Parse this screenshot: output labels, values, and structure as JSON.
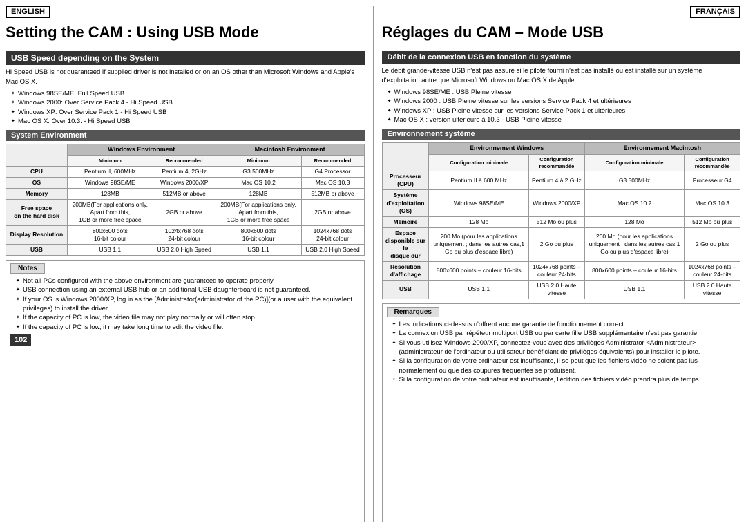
{
  "english": {
    "badge": "ENGLISH",
    "title": "Setting the CAM : Using USB Mode",
    "usb_speed_header": "USB Speed depending on the System",
    "intro": "Hi Speed USB is not guaranteed if supplied driver is not installed or on an OS other than Microsoft Windows and Apple's Mac OS X.",
    "bullets": [
      "Windows 98SE/ME: Full Speed USB",
      "Windows 2000: Over Service Pack 4 - Hi Speed USB",
      "Windows XP: Over Service Pack 1 - Hi Speed USB",
      "Mac OS X: Over 10.3. - Hi Speed USB"
    ],
    "system_env_header": "System Environment",
    "table": {
      "win_env": "Windows Environment",
      "mac_env": "Macintosh Environment",
      "min": "Minimum",
      "rec": "Recommended",
      "rows": [
        {
          "label": "CPU",
          "win_min": "Pentium II, 600MHz",
          "win_rec": "Pentium 4, 2GHz",
          "mac_min": "G3 500MHz",
          "mac_rec": "G4 Processor"
        },
        {
          "label": "OS",
          "win_min": "Windows 98SE/ME",
          "win_rec": "Windows 2000/XP",
          "mac_min": "Mac OS 10.2",
          "mac_rec": "Mac OS 10.3"
        },
        {
          "label": "Memory",
          "win_min": "128MB",
          "win_rec": "512MB or above",
          "mac_min": "128MB",
          "mac_rec": "512MB or above"
        },
        {
          "label": "Free space\non the hard disk",
          "win_min": "200MB(For applications only.\nApart from this,\n1GB or more free space",
          "win_rec": "2GB or above",
          "mac_min": "200MB(For applications only.\nApart from this,\n1GB or more free space",
          "mac_rec": "2GB or above"
        },
        {
          "label": "Display Resolution",
          "win_min": "800x600 dots\n16-bit colour",
          "win_rec": "1024x768 dots\n24-bit colour",
          "mac_min": "800x600 dots\n16-bit colour",
          "mac_rec": "1024x768 dots\n24-bit colour"
        },
        {
          "label": "USB",
          "win_min": "USB 1.1",
          "win_rec": "USB 2.0 High Speed",
          "mac_min": "USB 1.1",
          "mac_rec": "USB 2.0 High Speed"
        }
      ]
    },
    "notes_label": "Notes",
    "notes_bullets": [
      "Not all PCs configured with the above environment are guaranteed to operate properly.",
      "USB connection using an external USB hub or an additional USB daughterboard is not guaranteed.",
      "If your OS is Windows 2000/XP, log in as the [Administrator(administrator of the PC)](or a user with the equivalent privileges) to install the driver.",
      "If the capacity of PC is low, the video file may not play normally or will often stop.",
      "If the capacity of PC is low, it may take long time to edit the video file."
    ],
    "page_num": "102"
  },
  "french": {
    "badge": "FRANÇAIS",
    "title": "Réglages du CAM – Mode USB",
    "usb_speed_header": "Débit de la connexion USB en fonction du système",
    "intro": "Le débit grande-vitesse USB n'est pas assuré si le pilote fourni n'est pas installé ou est installé sur un système d'exploitation autre que Microsoft Windows ou Mac OS X de Apple.",
    "bullets": [
      "Windows 98SE/ME : USB Pleine vitesse",
      "Windows 2000 : USB Pleine vitesse sur les versions Service Pack 4 et ultérieures",
      "Windows XP : USB Pleine vitesse sur les versions Service Pack 1 et ultérieures",
      "Mac OS X : version ultérieure à 10.3 - USB Pleine vitesse"
    ],
    "system_env_header": "Environnement système",
    "table": {
      "win_env": "Environnement Windows",
      "mac_env": "Environnement Macintosh",
      "config_min": "Configuration minimale",
      "config_rec": "Configuration recommandée",
      "rows": [
        {
          "label": "Processeur\n(CPU)",
          "win_min": "Pentium II à 600 MHz",
          "win_rec": "Pentium 4 à 2 GHz",
          "mac_min": "G3 500MHz",
          "mac_rec": "Processeur G4"
        },
        {
          "label": "Système\nd'exploitation (OS)",
          "win_min": "Windows 98SE/ME",
          "win_rec": "Windows 2000/XP",
          "mac_min": "Mac OS 10.2",
          "mac_rec": "Mac OS 10.3"
        },
        {
          "label": "Mémoire",
          "win_min": "128 Mo",
          "win_rec": "512 Mo ou plus",
          "mac_min": "128 Mo",
          "mac_rec": "512 Mo ou plus"
        },
        {
          "label": "Espace\ndisponible sur le\ndisque dur",
          "win_min": "200 Mo (pour les applications uniquement ; dans les autres cas,1 Go ou plus d'espace libre)",
          "win_rec": "2 Go ou plus",
          "mac_min": "200 Mo (pour les applications uniquement ; dans les autres cas,1 Go ou plus d'espace libre)",
          "mac_rec": "2 Go ou plus"
        },
        {
          "label": "Résolution\nd'affichage",
          "win_min": "800x600 points – couleur 16-bits",
          "win_rec": "1024x768 points – couleur 24-bits",
          "mac_min": "800x600 points – couleur 16-bits",
          "mac_rec": "1024x768 points – couleur 24-bits"
        },
        {
          "label": "USB",
          "win_min": "USB 1.1",
          "win_rec": "USB 2.0 Haute vitesse",
          "mac_min": "USB 1.1",
          "mac_rec": "USB 2.0 Haute vitesse"
        }
      ]
    },
    "remarques_label": "Remarques",
    "notes_bullets": [
      "Les indications ci-dessus n'offrent aucune garantie de fonctionnement correct.",
      "La connexion USB par répéteur multiport USB ou par carte fille USB supplémentaire n'est pas garantie.",
      "Si vous utilisez Windows 2000/XP, connectez-vous avec des privilèges Administrator <Administrateur> (administrateur de l'ordinateur ou utilisateur bénéficiant de privilèges équivalents) pour installer le pilote.",
      "Si la configuration de votre ordinateur est insuffisante, il se peut que les fichiers vidéo ne soient pas lus normalement ou que des coupures fréquentes se produisent.",
      "Si la configuration de votre ordinateur est insuffisante, l'édition des fichiers vidéo prendra plus de temps."
    ]
  }
}
